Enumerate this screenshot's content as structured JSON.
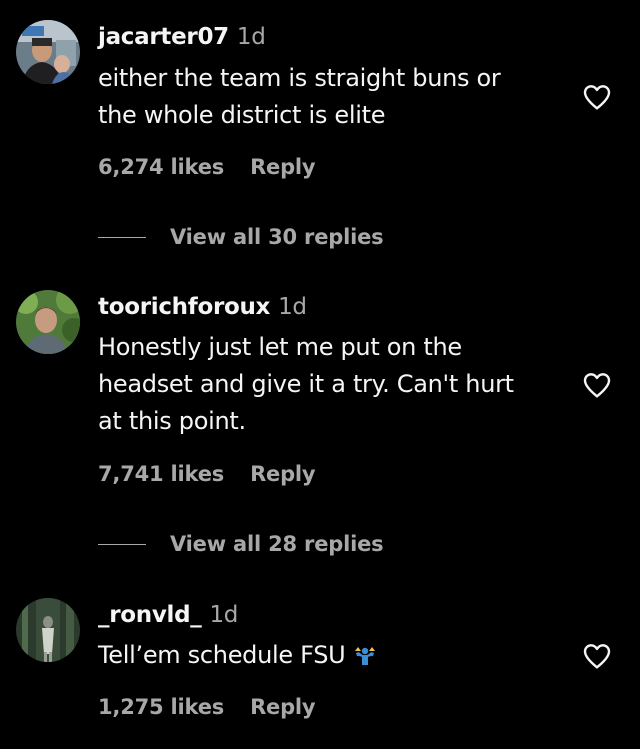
{
  "comments": [
    {
      "username": "jacarter07",
      "time": "1d",
      "lines": [
        "either the team is straight buns or",
        "the whole district is elite"
      ],
      "likes": "6,274 likes",
      "reply": "Reply",
      "view_replies": "View all 30 replies",
      "avatar_icon": "profile-photo-man-with-child"
    },
    {
      "username": "toorichforoux",
      "time": "1d",
      "lines": [
        "Honestly just let me put on the",
        "headset and give it a try. Can't hurt",
        "at this point."
      ],
      "likes": "7,741 likes",
      "reply": "Reply",
      "view_replies": "View all 28 replies",
      "avatar_icon": "profile-photo-man-outdoors"
    },
    {
      "username": "_ronvld_",
      "time": "1d",
      "lines": [
        "Tell’em schedule FSU"
      ],
      "emoji": "person-shrugging-emoji",
      "likes": "1,275 likes",
      "reply": "Reply",
      "avatar_icon": "profile-photo-dark-forest"
    }
  ],
  "colors": {
    "background": "#000000",
    "primary_text": "#f5f5f5",
    "secondary_text": "#a8a8a8",
    "emoji_blue": "#3b8fd9"
  },
  "icons": {
    "like": "heart-outline-icon"
  }
}
